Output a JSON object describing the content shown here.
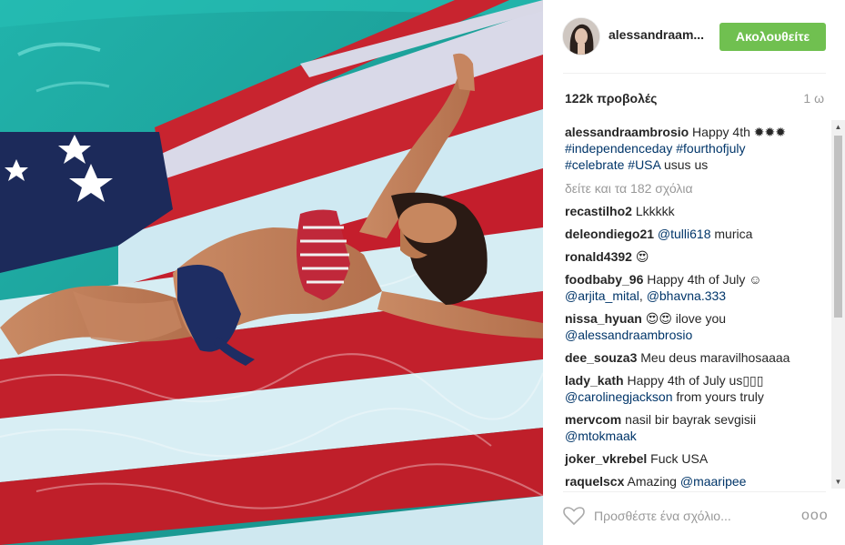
{
  "post": {
    "username": "alessandraam...",
    "follow_label": "Ακολουθείτε",
    "views": "122k προβολές",
    "time": "1 ω",
    "caption": {
      "user": "alessandraambrosio",
      "text_start": " Happy 4th ",
      "emoji": "✹✹✹",
      "tags": [
        "#independenceday",
        "#fourthofjuly",
        "#celebrate",
        "#USA"
      ],
      "text_end": " usus us"
    },
    "view_all": "δείτε και τα 182 σχόλια",
    "comments": [
      {
        "user": "recastilho2",
        "text": " Lkkkkk"
      },
      {
        "user": "deleondiego21",
        "mention": " @tulli618",
        "text": " murica"
      },
      {
        "user": "ronald4392",
        "text": " 😍"
      },
      {
        "user": "foodbaby_96",
        "text": " Happy 4th of July ☺",
        "mentions": [
          "@arjita_mital",
          "@bhavna.333"
        ],
        "sep": ", "
      },
      {
        "user": "nissa_hyuan",
        "text": " 😍😍 ilove you",
        "mention": "@alessandraambrosio"
      },
      {
        "user": "dee_souza3",
        "text": " Meu deus maravilhosaaaa"
      },
      {
        "user": "lady_kath",
        "text": " Happy 4th of July us▯▯▯",
        "mention": "@carolinegjackson",
        "tail": " from yours truly"
      },
      {
        "user": "mervcom",
        "text": " nasil bir bayrak sevgisii",
        "mention": "@mtokmaak"
      },
      {
        "user": "joker_vkrebel",
        "text": " Fuck USA"
      },
      {
        "user": "raquelscx",
        "text": " Amazing ",
        "mention": "@maaripee"
      }
    ],
    "add_comment_placeholder": "Προσθέστε ένα σχόλιο...",
    "more_options": "ooo"
  },
  "colors": {
    "follow_bg": "#70c050",
    "link": "#003569",
    "muted": "#999999"
  },
  "icons": {
    "like": "heart-outline-icon",
    "options": "ellipsis-icon",
    "scroll_up": "scroll-up-arrow-icon",
    "scroll_down": "scroll-down-arrow-icon"
  }
}
